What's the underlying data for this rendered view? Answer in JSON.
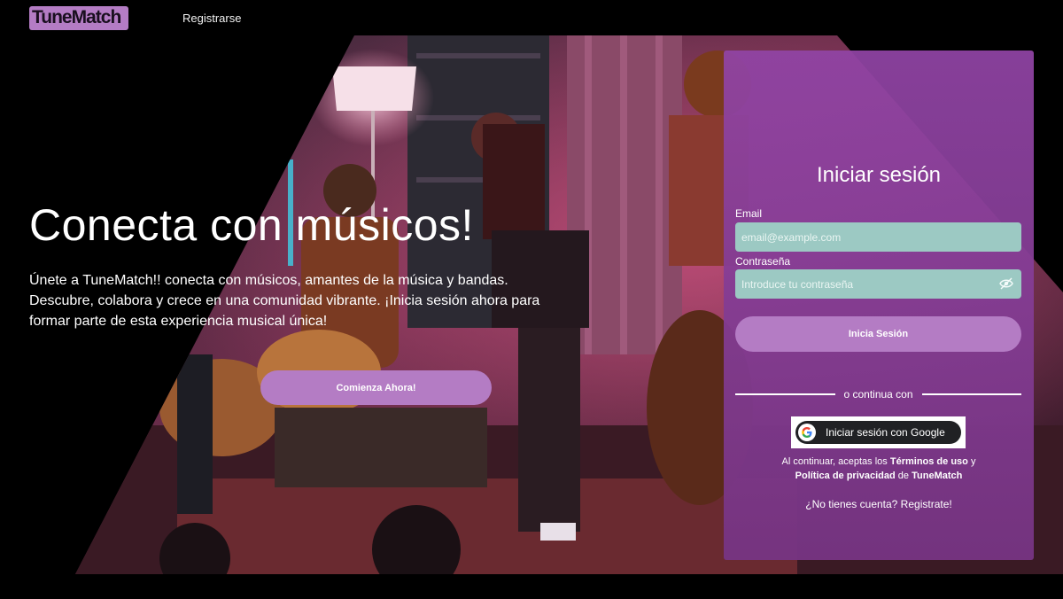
{
  "header": {
    "logo_text": "TuneMatch",
    "register_link": "Registrarse"
  },
  "hero": {
    "title": "Conecta con músicos!",
    "description": "Únete a TuneMatch!! conecta con músicos, amantes de la música y bandas. Descubre, colabora y crece en una comunidad vibrante. ¡Inicia sesión ahora para formar parte de esta experiencia musical única!",
    "cta_label": "Comienza Ahora!"
  },
  "login": {
    "title": "Iniciar sesión",
    "email_label": "Email",
    "email_placeholder": "email@example.com",
    "password_label": "Contraseña",
    "password_placeholder": "Introduce tu contraseña",
    "submit_label": "Inicia Sesión",
    "divider_text": "o continua con",
    "google_label": "Iniciar sesión con Google",
    "terms_prefix": "Al continuar, aceptas los",
    "terms_link": "Términos de uso",
    "terms_and": "y",
    "privacy_link": "Política de privacidad",
    "privacy_of": "de",
    "brand": "TuneMatch",
    "signup_text": "¿No tienes cuenta? Registrate!"
  },
  "colors": {
    "accent": "#b47cc4",
    "card_top": "#9144a5",
    "input_bg": "#9cc9c3",
    "background": "#000000"
  },
  "icons": [
    "google-icon",
    "eye-off-icon"
  ]
}
